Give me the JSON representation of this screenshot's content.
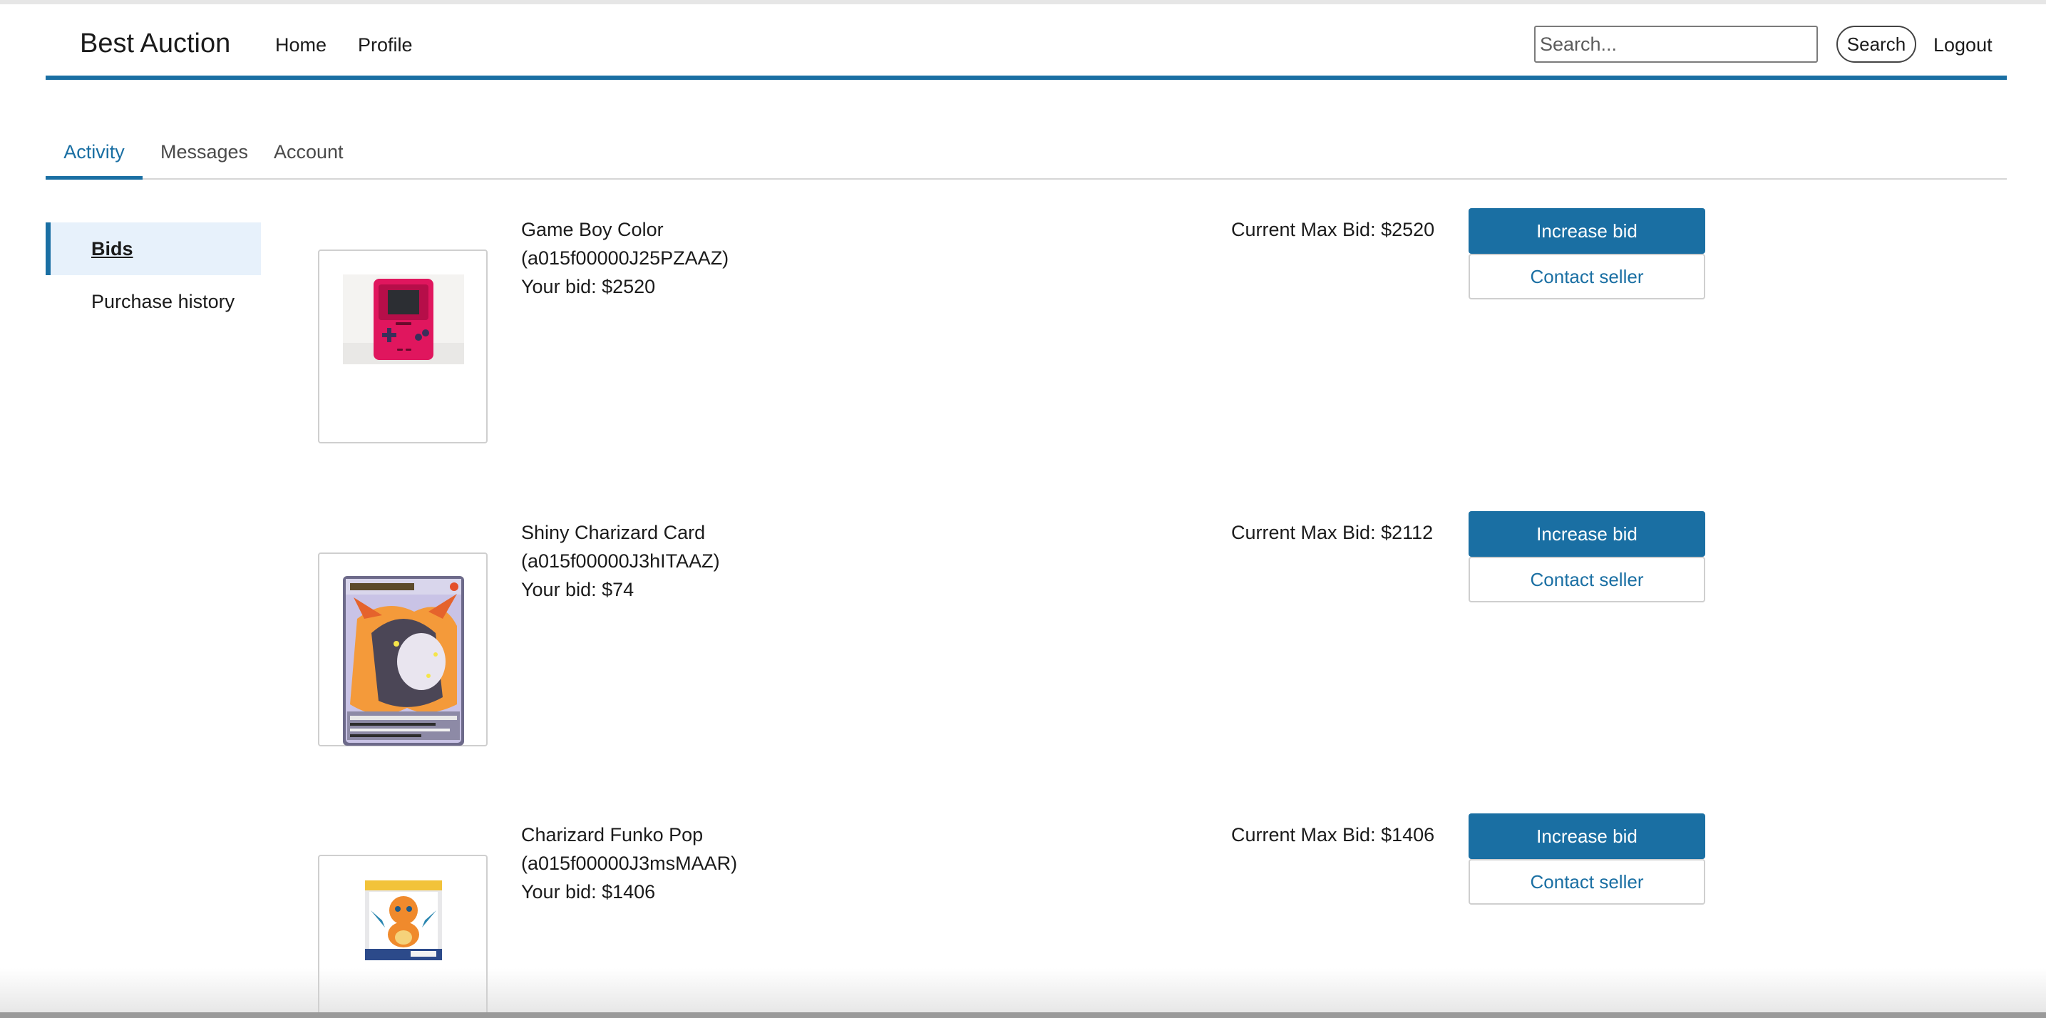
{
  "header": {
    "brand": "Best Auction",
    "nav": {
      "home": "Home",
      "profile": "Profile"
    },
    "search": {
      "placeholder": "Search...",
      "button_label": "Search"
    },
    "logout_label": "Logout",
    "accent_color": "#1a6fa3"
  },
  "tabs": [
    {
      "label": "Activity",
      "active": true
    },
    {
      "label": "Messages",
      "active": false
    },
    {
      "label": "Account",
      "active": false
    }
  ],
  "sidebar": {
    "items": [
      {
        "label": "Bids",
        "active": true
      },
      {
        "label": "Purchase history",
        "active": false
      }
    ]
  },
  "bids": [
    {
      "name": "Game Boy Color",
      "id": "(a015f00000J25PZAAZ)",
      "your_bid": "Your bid: $2520",
      "current_max": "Current Max Bid: $2520",
      "image_icon": "game-boy-color-image",
      "increase_label": "Increase bid",
      "contact_label": "Contact seller"
    },
    {
      "name": "Shiny Charizard Card",
      "id": "(a015f00000J3hITAAZ)",
      "your_bid": "Your bid: $74",
      "current_max": "Current Max Bid: $2112",
      "image_icon": "charizard-card-image",
      "increase_label": "Increase bid",
      "contact_label": "Contact seller"
    },
    {
      "name": "Charizard Funko Pop",
      "id": "(a015f00000J3msMAAR)",
      "your_bid": "Your bid: $1406",
      "current_max": "Current Max Bid: $1406",
      "image_icon": "funko-pop-box-image",
      "increase_label": "Increase bid",
      "contact_label": "Contact seller"
    }
  ]
}
